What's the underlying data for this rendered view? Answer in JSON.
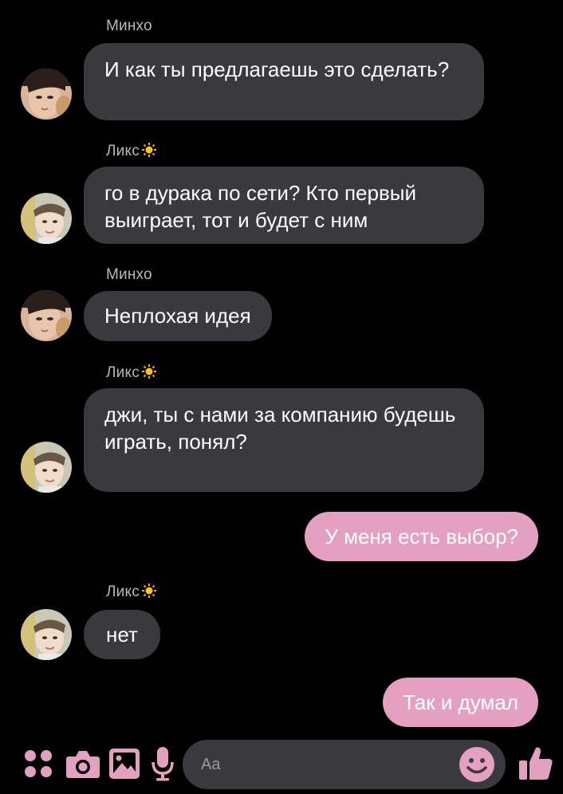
{
  "conversation": {
    "messages": [
      {
        "direction": "incoming",
        "sender": "Минхо",
        "text": "И как ты предлагаешь это сделать?"
      },
      {
        "direction": "incoming",
        "sender": "Ликс",
        "text": "го в дурака по сети? Кто первый выиграет, тот и будет с ним"
      },
      {
        "direction": "incoming",
        "sender": "Минхо",
        "text": "Неплохая идея"
      },
      {
        "direction": "incoming",
        "sender": "Ликс",
        "text": "джи, ты с нами за компанию будешь играть, понял?"
      },
      {
        "direction": "outgoing",
        "sender": "",
        "text": "У меня есть выбор?"
      },
      {
        "direction": "incoming",
        "sender": "Ликс",
        "text": "нет"
      },
      {
        "direction": "outgoing",
        "sender": "",
        "text": "Так и думал"
      }
    ]
  },
  "composer": {
    "placeholder": "Aa",
    "icons": [
      "apps-icon",
      "camera-icon",
      "gallery-icon",
      "microphone-icon",
      "emoji-icon",
      "like-icon"
    ]
  },
  "colors": {
    "background": "#000000",
    "incoming_bubble": "#3a393e",
    "outgoing_bubble": "#e4a0c0",
    "accent": "#e4a0c0",
    "sender_name": "#b8b8b8"
  }
}
